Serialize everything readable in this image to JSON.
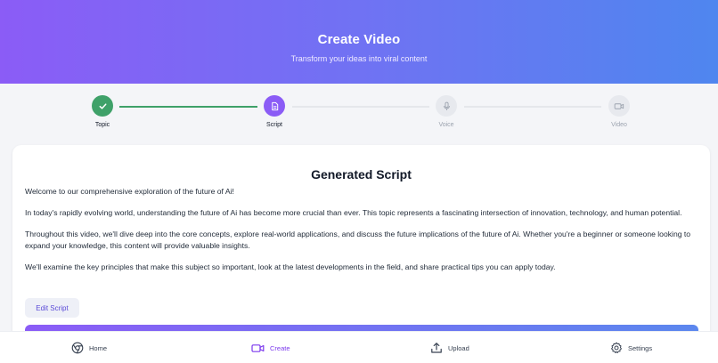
{
  "header": {
    "title": "Create Video",
    "subtitle": "Transform your ideas into viral content"
  },
  "steps": [
    {
      "label": "Topic",
      "status": "done",
      "icon": "check-icon"
    },
    {
      "label": "Script",
      "status": "active",
      "icon": "document-icon"
    },
    {
      "label": "Voice",
      "status": "todo",
      "icon": "microphone-icon"
    },
    {
      "label": "Video",
      "status": "todo",
      "icon": "video-camera-icon"
    }
  ],
  "script_card": {
    "title": "Generated Script",
    "paragraphs": [
      "Welcome to our comprehensive exploration of the future of Ai!",
      "In today's rapidly evolving world, understanding the future of Ai has become more crucial than ever. This topic represents a fascinating intersection of innovation, technology, and human potential.",
      "Throughout this video, we'll dive deep into the core concepts, explore real-world applications, and discuss the future implications of the future of Ai. Whether you're a beginner or someone looking to expand your knowledge, this content will provide valuable insights.",
      "We'll examine the key principles that make this subject so important, look at the latest developments in the field, and share practical tips you can apply today."
    ],
    "edit_label": "Edit Script"
  },
  "nav": {
    "items": [
      {
        "label": "Home",
        "icon": "home-icon"
      },
      {
        "label": "Create",
        "icon": "video-camera-icon"
      },
      {
        "label": "Upload",
        "icon": "upload-icon"
      },
      {
        "label": "Settings",
        "icon": "gear-icon"
      }
    ],
    "active": "Create"
  },
  "colors": {
    "accent": "#8b5cf6",
    "gradient_start": "#8b5cf6",
    "gradient_end": "#4f86ef",
    "done": "#3fa169",
    "todo": "#e7e9ee"
  }
}
